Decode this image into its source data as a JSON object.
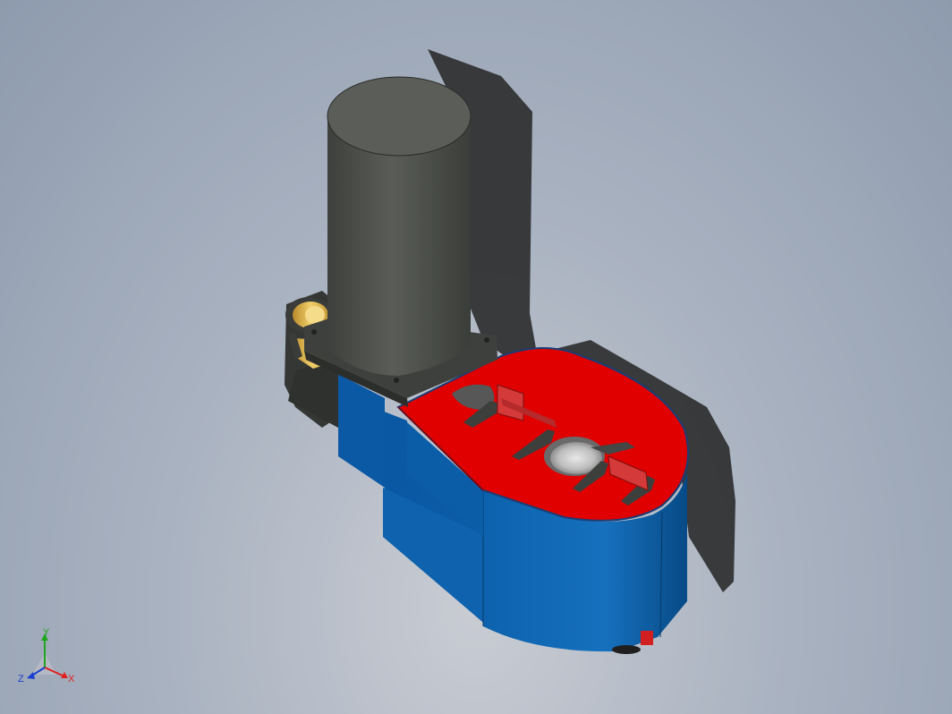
{
  "viewport": {
    "background_top": "#8e9bae",
    "background_bottom": "#c9ccd3"
  },
  "model": {
    "colors": {
      "housing_blue": "#0a5fa8",
      "housing_blue_dark": "#084a86",
      "housing_blue_light": "#1a74c2",
      "top_red": "#e00000",
      "motor_gray": "#4a4d48",
      "motor_gray_light": "#5d605a",
      "bracket_dark": "#3a3c3a",
      "bearing_yellow": "#e8c456",
      "shadow": "#2c2c2c"
    }
  },
  "triad": {
    "x_label": "X",
    "y_label": "Y",
    "z_label": "Z",
    "x_color": "#e02020",
    "y_color": "#1fa51f",
    "z_color": "#1a3fd0"
  }
}
